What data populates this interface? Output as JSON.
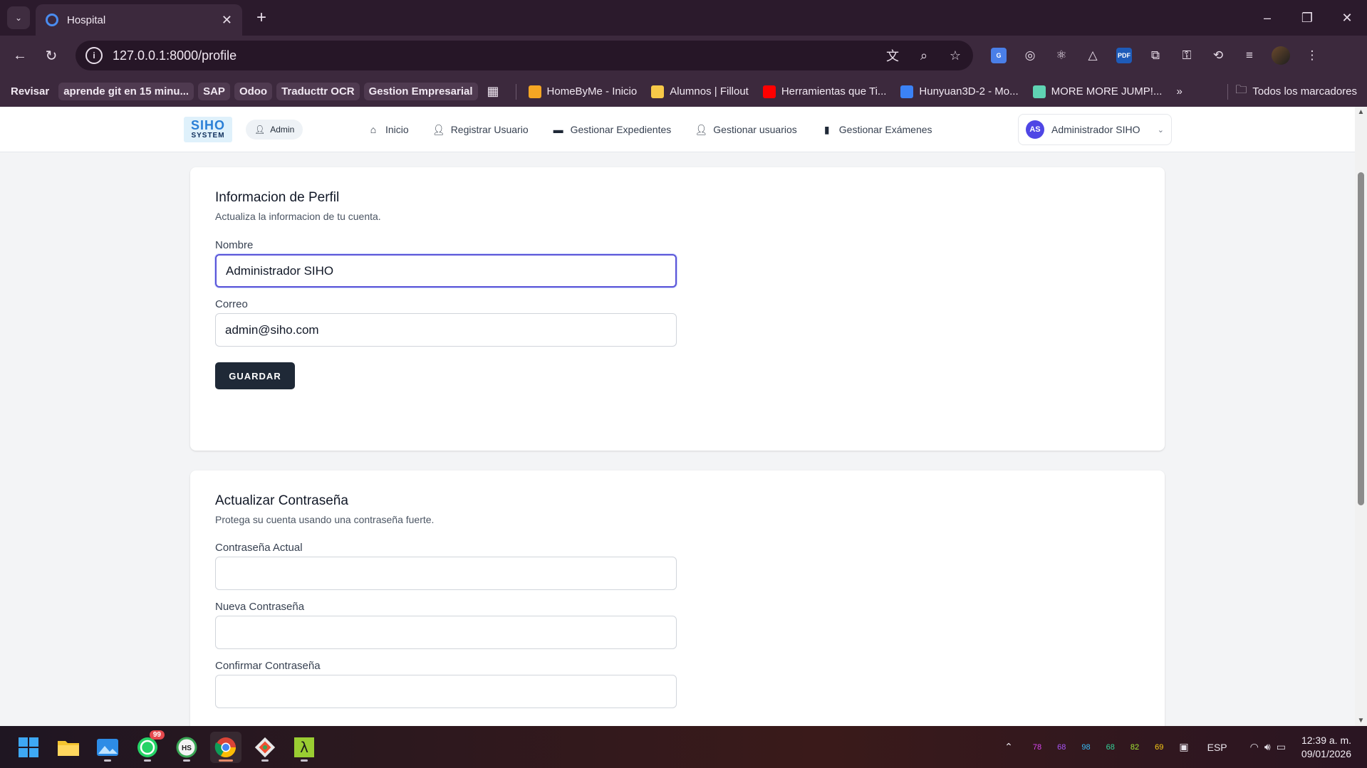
{
  "browser": {
    "tab_title": "Hospital",
    "url": "127.0.0.1:8000/profile",
    "bookmarks": [
      {
        "label": "Revisar",
        "boxed": false
      },
      {
        "label": "aprende git en 15 minu...",
        "boxed": true
      },
      {
        "label": "SAP",
        "boxed": true
      },
      {
        "label": "Odoo",
        "boxed": true
      },
      {
        "label": "Traducttr OCR",
        "boxed": true
      },
      {
        "label": "Gestion Empresarial",
        "boxed": true
      }
    ],
    "bookmarks_icon": [
      {
        "label": "HomeByMe - Inicio",
        "color": "#f5a623"
      },
      {
        "label": "Alumnos | Fillout",
        "color": "#f7c948"
      },
      {
        "label": "Herramientas que Ti...",
        "color": "#ff0000"
      },
      {
        "label": "Hunyuan3D-2 - Mo...",
        "color": "#3b82f6"
      },
      {
        "label": "MORE MORE JUMP!...",
        "color": "#5fd3b3"
      }
    ],
    "all_bookmarks": "Todos los marcadores"
  },
  "app": {
    "logo_top": "SIHO",
    "logo_bottom": "SYSTEM",
    "role": "Admin",
    "nav": [
      "Inicio",
      "Registrar Usuario",
      "Gestionar Expedientes",
      "Gestionar usuarios",
      "Gestionar Exámenes"
    ],
    "user_initials": "AS",
    "user_name": "Administrador SIHO"
  },
  "profile": {
    "title": "Informacion de Perfil",
    "subtitle": "Actualiza la informacion de tu cuenta.",
    "name_label": "Nombre",
    "name_value": "Administrador SIHO",
    "email_label": "Correo",
    "email_value": "admin@siho.com",
    "save_label": "GUARDAR"
  },
  "password": {
    "title": "Actualizar Contraseña",
    "subtitle": "Protega su cuenta usando una contraseña fuerte.",
    "current_label": "Contraseña Actual",
    "new_label": "Nueva Contraseña",
    "confirm_label": "Confirmar Contraseña"
  },
  "taskbar": {
    "whatsapp_badge": "99",
    "tray_numbers": [
      {
        "value": "78",
        "color": "#d946ef"
      },
      {
        "value": "68",
        "color": "#a855f7"
      },
      {
        "value": "98",
        "color": "#38bdf8"
      },
      {
        "value": "68",
        "color": "#34d399"
      },
      {
        "value": "82",
        "color": "#a3e635"
      },
      {
        "value": "69",
        "color": "#facc15"
      }
    ],
    "language": "ESP",
    "time": "12:39 a. m.",
    "date": "09/01/2026"
  },
  "colors": {
    "accent": "#4f46e5",
    "primary_button": "#1f2937",
    "focus_ring": "#5b55d8"
  }
}
